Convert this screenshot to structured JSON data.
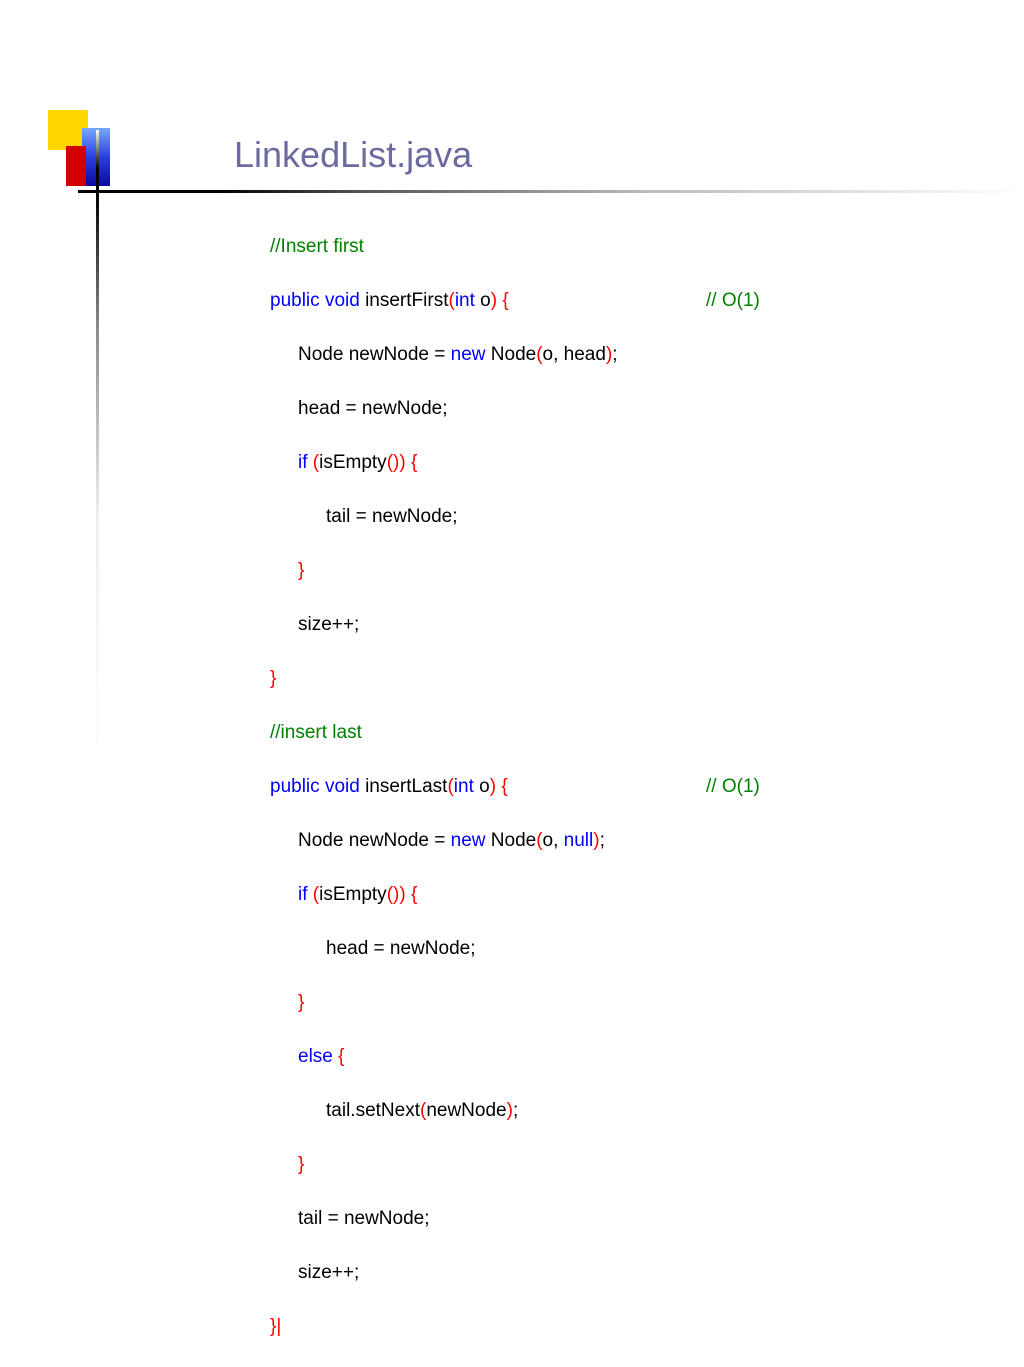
{
  "title": "LinkedList.java",
  "cmt": {
    "insertFirst": "//Insert first",
    "insertLast": "//insert last",
    "o1a": "// O(1)",
    "o1b": "// O(1)"
  },
  "kw": {
    "public": "public",
    "void": "void",
    "int": "int",
    "new": "new",
    "if": "if",
    "else": "else",
    "null": "null"
  },
  "id": {
    "insertFirst": "insertFirst",
    "insertLast": "insertLast",
    "o": "o",
    "Node": "Node",
    "newNode": "newNode",
    "head": "head",
    "tail": "tail",
    "isEmpty": "isEmpty",
    "size": "size",
    "setNext": "setNext"
  },
  "txt": {
    "sp": " ",
    "eq": " = ",
    "cm": ", ",
    "sc": ";",
    "pp": "++",
    "dot": ".",
    "assignNewNodeSc": " = newNode;",
    "headAssign": "head = newNode;",
    "tailAssign": "tail = newNode;",
    "sizepp": "size++;"
  },
  "p": {
    "op": "(",
    "cp": ")",
    "ob": "{",
    "cb": "}",
    "cpsp": ") ",
    "opcp": "()",
    "cpspob": ") {",
    "cbbar": "}|"
  }
}
